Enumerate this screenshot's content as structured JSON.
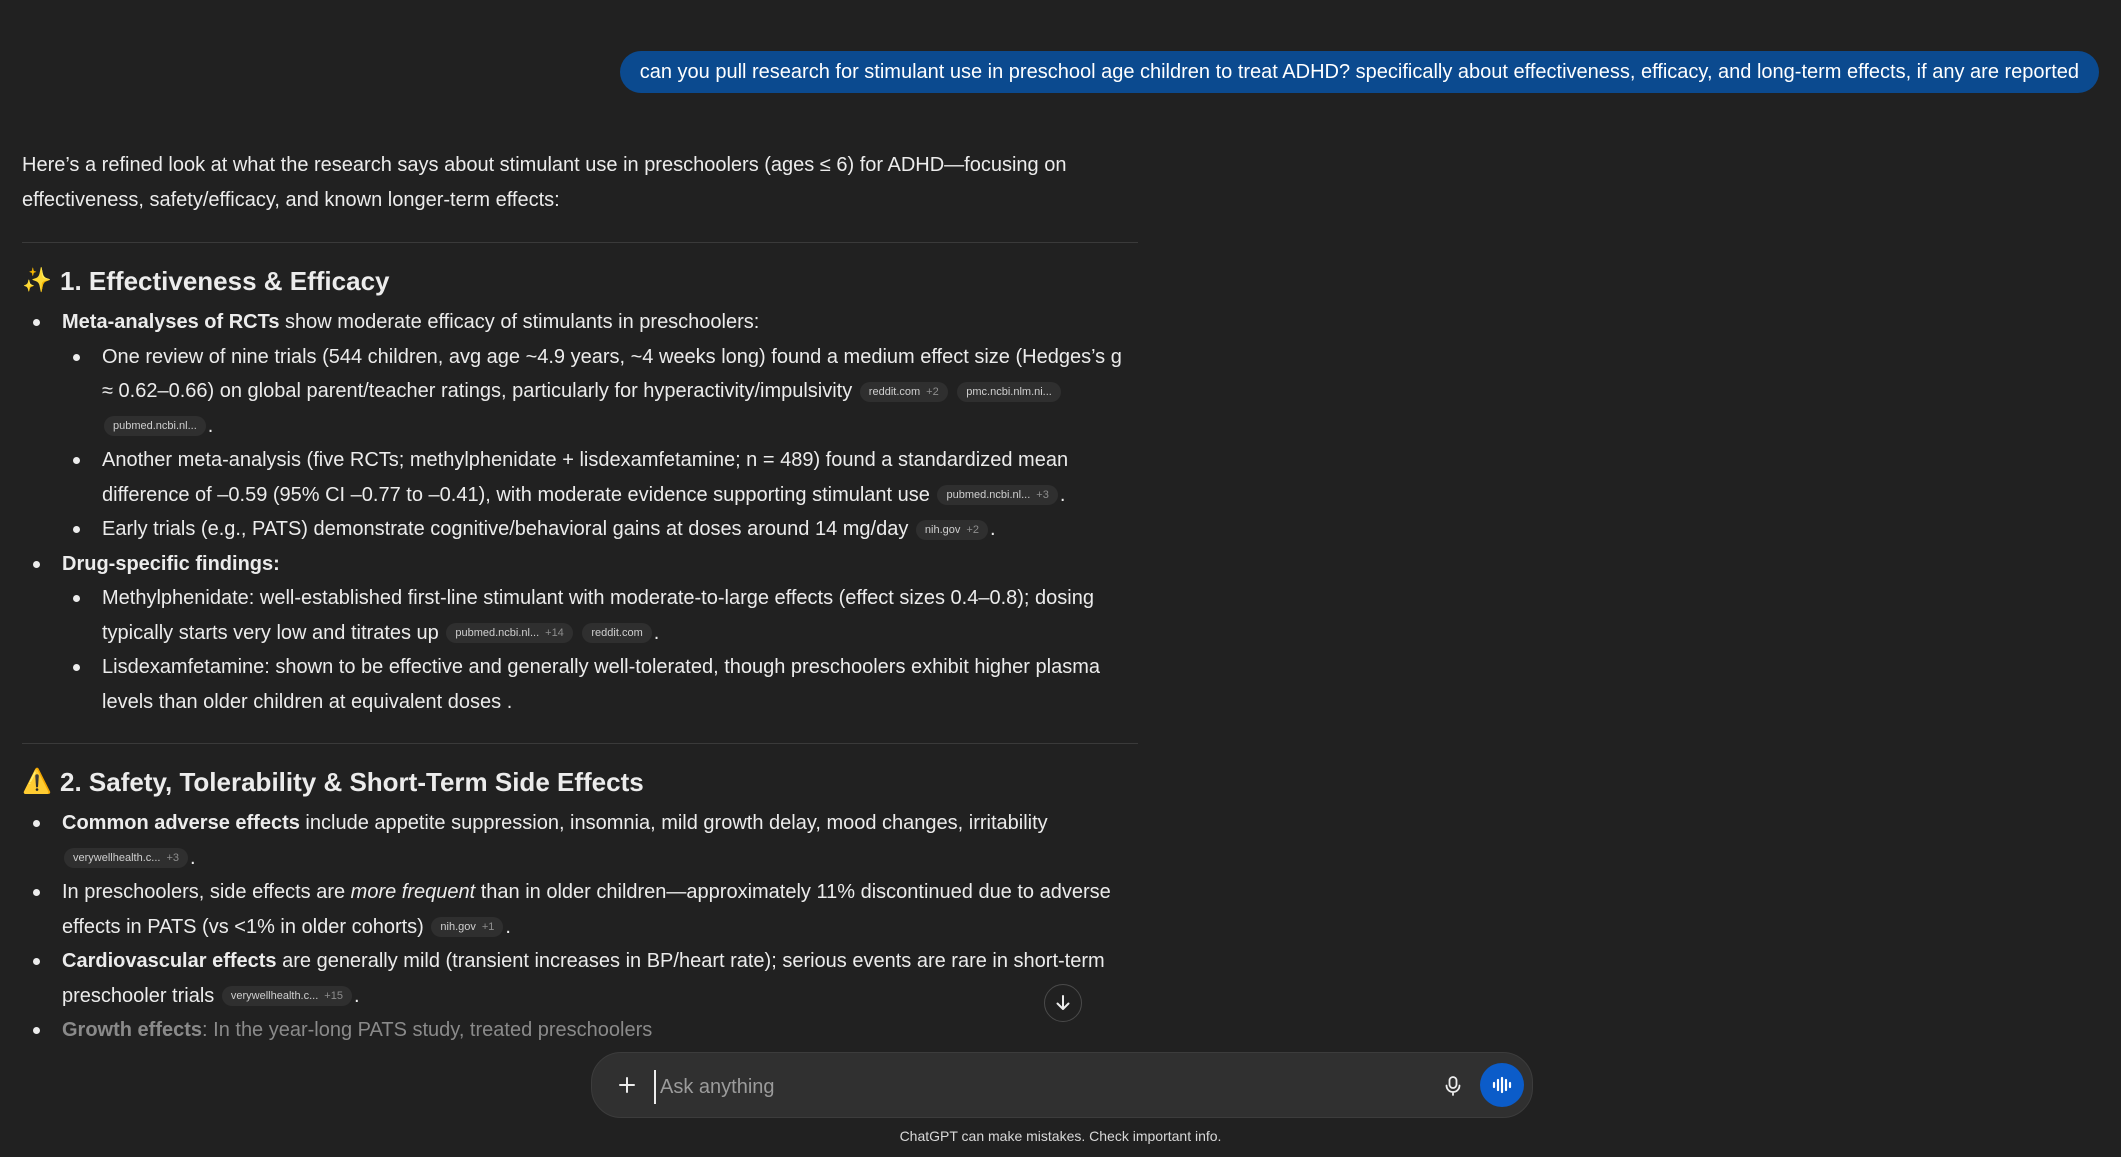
{
  "user_message": "can you pull research for stimulant use in preschool age children to treat ADHD? specifically about effectiveness, efficacy, and long-term effects, if any are reported",
  "answer": {
    "intro": "Here’s a refined look at what the research says about stimulant use in preschoolers (ages ≤ 6) for ADHD—focusing on effectiveness, safety/efficacy, and known longer-term effects:",
    "section1": {
      "emoji": "✨",
      "title": "1. Effectiveness & Efficacy",
      "b1_bold": "Meta-analyses of RCTs",
      "b1_text": " show moderate efficacy of stimulants in preschoolers:",
      "s1": "One review of nine trials (544 children, avg age ~4.9 years, ~4 weeks long) found a medium effect size (Hedges’s g ≈ 0.62–0.66) on global parent/teacher ratings, particularly for hyperactivity/impulsivity",
      "s1_chip1": "reddit.com",
      "s1_chip1_more": "+2",
      "s1_chip2": "pmc.ncbi.nlm.ni...",
      "s1_chip3": "pubmed.ncbi.nl...",
      "s2": "Another meta-analysis (five RCTs; methylphenidate + lisdexamfetamine; n = 489) found a standardized mean difference of –0.59 (95% CI –0.77 to –0.41), with moderate evidence supporting stimulant use",
      "s2_chip1": "pubmed.ncbi.nl...",
      "s2_chip1_more": "+3",
      "s3": "Early trials (e.g., PATS) demonstrate cognitive/behavioral gains at doses around 14 mg/day",
      "s3_chip1": "nih.gov",
      "s3_chip1_more": "+2",
      "b2_bold": "Drug-specific findings:",
      "d1": "Methylphenidate: well-established first-line stimulant with moderate-to-large effects (effect sizes 0.4–0.8); dosing typically starts very low and titrates up",
      "d1_chip1": "pubmed.ncbi.nl...",
      "d1_chip1_more": "+14",
      "d1_chip2": "reddit.com",
      "d2": "Lisdexamfetamine: shown to be effective and generally well-tolerated, though preschoolers exhibit higher plasma levels than older children at equivalent doses ."
    },
    "section2": {
      "emoji": "⚠️",
      "title": "2. Safety, Tolerability & Short-Term Side Effects",
      "b1_bold": "Common adverse effects",
      "b1_text": " include appetite suppression, insomnia, mild growth delay, mood changes, irritability",
      "b1_chip1": "verywellhealth.c...",
      "b1_chip1_more": "+3",
      "b2_pre": "In preschoolers, side effects are ",
      "b2_em": "more frequent",
      "b2_post": " than in older children—approximately 11% discontinued due to adverse effects in PATS (vs <1% in older cohorts)",
      "b2_chip1": "nih.gov",
      "b2_chip1_more": "+1",
      "b3_bold": "Cardiovascular effects",
      "b3_text": " are generally mild (transient increases in BP/heart rate); serious events are rare in short-term preschooler trials",
      "b3_chip1": "verywellhealth.c...",
      "b3_chip1_more": "+15",
      "b4_bold": "Growth effects",
      "b4_text": ": In the year-long PATS study, treated preschoolers"
    }
  },
  "composer": {
    "placeholder": "Ask anything"
  },
  "disclaimer": "ChatGPT can make mistakes. Check important info."
}
